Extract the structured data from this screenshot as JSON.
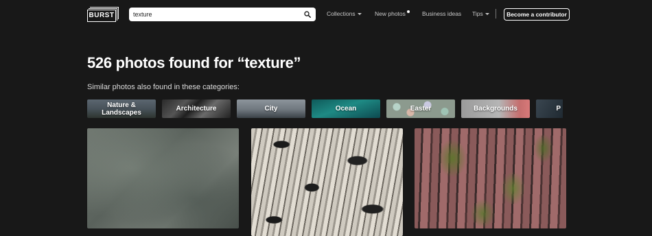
{
  "header": {
    "logo": "BURST",
    "search": {
      "value": "texture"
    },
    "nav": {
      "collections": "Collections",
      "new_photos": "New photos",
      "business_ideas": "Business ideas",
      "tips": "Tips"
    },
    "contributor_button": "Become a contributor"
  },
  "main": {
    "title": "526 photos found for “texture”",
    "subtitle": "Similar photos also found in these categories:",
    "categories": [
      {
        "label": "Nature &\nLandscapes"
      },
      {
        "label": "Architecture"
      },
      {
        "label": "City"
      },
      {
        "label": "Ocean"
      },
      {
        "label": "Easter"
      },
      {
        "label": "Backgrounds"
      },
      {
        "label": "P"
      }
    ],
    "photos": [
      {
        "subject": "stone texture"
      },
      {
        "subject": "birch bark texture"
      },
      {
        "subject": "pine bark with moss"
      }
    ]
  },
  "colors": {
    "background": "#181818",
    "text": "#ffffff",
    "nav_text": "#c8c8c8"
  }
}
